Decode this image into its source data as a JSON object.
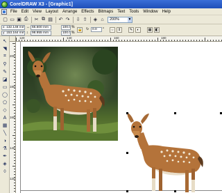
{
  "window": {
    "title": "CorelDRAW X3 - [Graphic1]"
  },
  "menu": {
    "items": [
      "File",
      "Edit",
      "View",
      "Layout",
      "Arrange",
      "Effects",
      "Bitmaps",
      "Text",
      "Tools",
      "Window",
      "Help"
    ]
  },
  "toolbar": {
    "zoom": "200%",
    "icons": [
      "new-icon",
      "open-icon",
      "save-icon",
      "print-icon",
      "cut-icon",
      "copy-icon",
      "paste-icon",
      "undo-icon",
      "redo-icon",
      "import-icon",
      "export-icon",
      "app-launcher-icon",
      "welcome-icon",
      "zoom-level"
    ]
  },
  "property_bar": {
    "x": "x: 132.148 mm",
    "y": "y: 153.164 mm",
    "width": "66.600 mm",
    "height": "98.955 mm",
    "scale_w": "100.0",
    "scale_h": "100.0",
    "scale_unit": "%",
    "rotation": "0.0",
    "rotation_unit": "°"
  },
  "rulers": {
    "h_labels": [
      "120",
      "140",
      "160",
      "180"
    ],
    "v_labels": [
      "200",
      "180",
      "160",
      "140",
      "120"
    ]
  },
  "colors": {
    "titlebar": "#245edb",
    "chrome": "#ece9d8",
    "canvas": "#ffffff"
  }
}
